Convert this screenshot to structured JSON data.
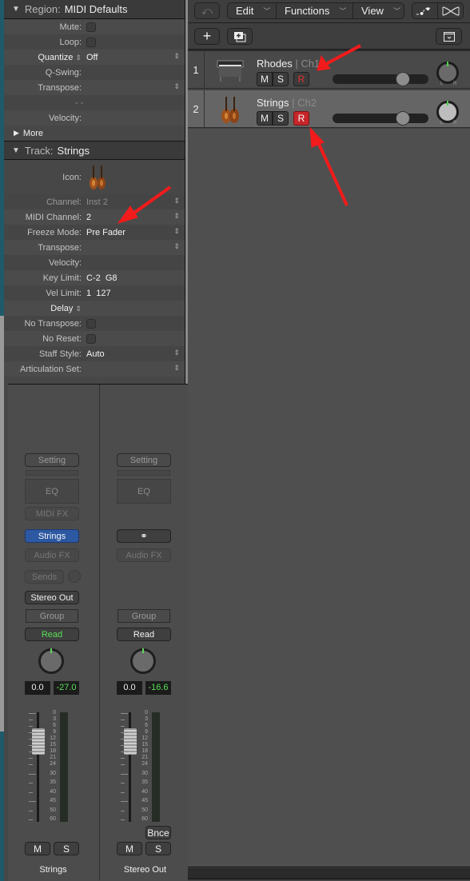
{
  "region": {
    "header_key": "Region:",
    "header_value": "MIDI Defaults",
    "rows": [
      {
        "label": "Mute:",
        "type": "checkbox"
      },
      {
        "label": "Loop:",
        "type": "checkbox"
      },
      {
        "label": "Quantize",
        "value": "Off",
        "type": "popup"
      },
      {
        "label": "Q-Swing:",
        "value": ""
      },
      {
        "label": "Transpose:",
        "value": "",
        "type": "popup"
      },
      {
        "label": "",
        "value": "- -"
      },
      {
        "label": "Velocity:",
        "value": ""
      }
    ],
    "more_label": "More"
  },
  "track": {
    "header_key": "Track:",
    "header_value": "Strings",
    "icon_label": "Icon:",
    "icon": "violin-icon",
    "rows": [
      {
        "label": "Channel:",
        "value": "Inst 2"
      },
      {
        "label": "MIDI Channel:",
        "value": "2"
      },
      {
        "label": "Freeze Mode:",
        "value": "Pre Fader"
      },
      {
        "label": "Transpose:",
        "value": ""
      },
      {
        "label": "Velocity:",
        "value": ""
      },
      {
        "label": "Key Limit:",
        "value": "C-2  G8"
      },
      {
        "label": "Vel Limit:",
        "value": "1  127"
      },
      {
        "label": "Delay",
        "value": ""
      },
      {
        "label": "No Transpose:",
        "type": "checkbox"
      },
      {
        "label": "No Reset:",
        "type": "checkbox"
      },
      {
        "label": "Staff Style:",
        "value": "Auto"
      },
      {
        "label": "Articulation Set:",
        "value": ""
      }
    ]
  },
  "mixer": {
    "strips": [
      {
        "setting": "Setting",
        "eq": "EQ",
        "midi_fx": "MIDI FX",
        "input": "Strings",
        "audio_fx": "Audio FX",
        "sends": "Sends",
        "output": "Stereo Out",
        "group": "Group",
        "automation": "Read",
        "volume": "0.0",
        "peak": "-27.0",
        "mute": "M",
        "solo": "S",
        "name": "Strings"
      },
      {
        "setting": "Setting",
        "eq": "EQ",
        "input": "stereo-link-icon",
        "audio_fx": "Audio FX",
        "group": "Group",
        "automation": "Read",
        "volume": "0.0",
        "peak": "-16.6",
        "bounce": "Bnce",
        "mute": "M",
        "solo": "S",
        "name": "Stereo Out"
      }
    ],
    "meter_scale": [
      "0",
      "3",
      "6",
      "9",
      "12",
      "15",
      "18",
      "21",
      "24",
      "30",
      "35",
      "40",
      "45",
      "50",
      "60"
    ]
  },
  "toolbar": {
    "back_icon": "back-arrow-icon",
    "edit": "Edit",
    "functions": "Functions",
    "view": "View",
    "automation_icon": "automation-curve-icon",
    "flex_icon": "flex-icon",
    "add_icon": "plus-icon",
    "duplicate_icon": "new-track-duplicate-icon",
    "collapse_icon": "collapse-icon"
  },
  "tracks": [
    {
      "number": "1",
      "name": "Rhodes",
      "channel": "Ch1",
      "mute": "M",
      "solo": "S",
      "record": "R",
      "record_armed": false,
      "volume_fraction": 0.73,
      "icon": "electric-piano-icon",
      "pan_l": "L",
      "pan_r": "R"
    },
    {
      "number": "2",
      "name": "Strings",
      "channel": "Ch2",
      "mute": "M",
      "solo": "S",
      "record": "R",
      "record_armed": true,
      "volume_fraction": 0.73,
      "icon": "violin-icon",
      "pan_l": "L",
      "pan_r": "R"
    }
  ],
  "colors": {
    "record_active": "#c8262a",
    "record_inactive_text": "#e03030",
    "annotation_arrow": "#f21b1b",
    "input_blue": "#2d59a3",
    "meter_green": "#5fd75f"
  }
}
